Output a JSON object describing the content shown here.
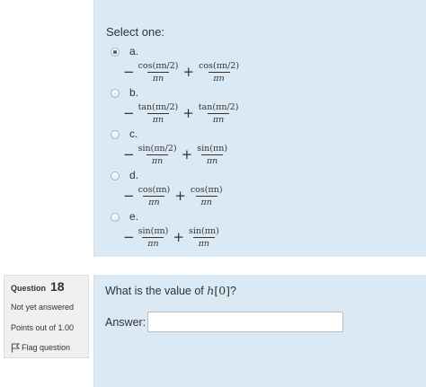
{
  "question1": {
    "prompt": "Select one:",
    "selected_option": "a",
    "options": [
      {
        "letter": "a.",
        "sign1": "−",
        "num1": "cos(πn/2)",
        "den1": "πn",
        "op": "+",
        "num2": "cos(πn/2)",
        "den2": "πn",
        "checked": true
      },
      {
        "letter": "b.",
        "sign1": "−",
        "num1": "tan(πn/2)",
        "den1": "πn",
        "op": "+",
        "num2": "tan(πn/2)",
        "den2": "πn",
        "checked": false
      },
      {
        "letter": "c.",
        "sign1": "−",
        "num1": "sin(πn/2)",
        "den1": "πn",
        "op": "+",
        "num2": "sin(πn)",
        "den2": "πn",
        "checked": false
      },
      {
        "letter": "d.",
        "sign1": "−",
        "num1": "cos(πn)",
        "den1": "πn",
        "op": "+",
        "num2": "cos(πn)",
        "den2": "πn",
        "checked": false
      },
      {
        "letter": "e.",
        "sign1": "−",
        "num1": "sin(πn)",
        "den1": "πn",
        "op": "+",
        "num2": "sin(πn)",
        "den2": "πn",
        "checked": false
      }
    ]
  },
  "question2_info": {
    "label": "Question",
    "number": "18",
    "state": "Not yet answered",
    "points": "Points out of 1.00",
    "flag_label": "Flag question"
  },
  "question2": {
    "text_before": "What is the value of ",
    "math_h": "h",
    "math_bracket": "[0]",
    "text_after": "?",
    "answer_label": "Answer:",
    "answer_value": ""
  }
}
